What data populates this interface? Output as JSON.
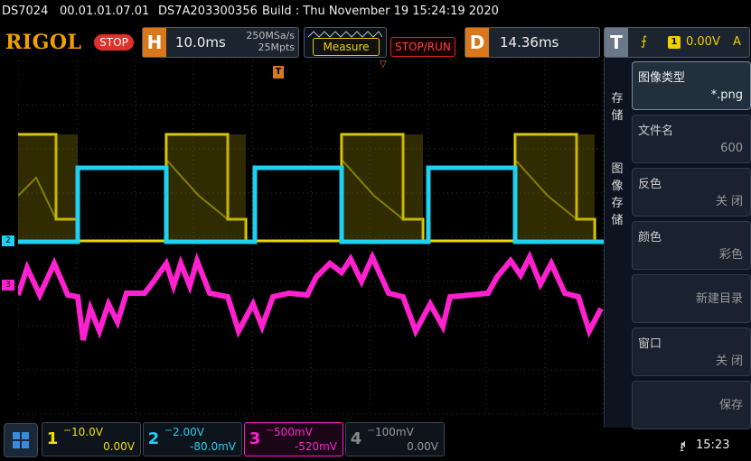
{
  "info": {
    "model": "DS7024",
    "version": "00.01.01.07.01",
    "serial": "DS7A203300356",
    "build": "Build : Thu November 19 15:24:19 2020"
  },
  "toolbar": {
    "logo": "RIGOL",
    "run_state": "STOP",
    "horizontal_letter": "H",
    "timebase": "10.0ms",
    "sample_rate": "250MSa/s",
    "memory_depth": "25Mpts",
    "measure_label": "Measure",
    "stop_run_label": "STOP/RUN",
    "delay_letter": "D",
    "delay_value": "14.36ms",
    "trigger_letter": "T",
    "trigger_source": "1",
    "trigger_level": "0.00V",
    "trigger_mode": "A"
  },
  "markers": {
    "ch2": "2",
    "ch3": "3",
    "trigger": "T"
  },
  "panel": {
    "tab_save": "存\n储",
    "tab_image_save": "图\n像\n存\n储",
    "items": [
      {
        "label": "图像类型",
        "value": "*.png"
      },
      {
        "label": "文件名",
        "value": "600"
      },
      {
        "label": "反色",
        "value": "关 闭"
      },
      {
        "label": "颜色",
        "value": "彩色"
      },
      {
        "label": "",
        "value": "新建目录"
      },
      {
        "label": "窗口",
        "value": "关 闭"
      },
      {
        "label": "",
        "value": "保存"
      }
    ]
  },
  "channels": [
    {
      "num": "1",
      "scale": "10.0V",
      "offset": "0.00V",
      "color": "#f0e000"
    },
    {
      "num": "2",
      "scale": "2.00V",
      "offset": "-80.0mV",
      "color": "#20d0f0"
    },
    {
      "num": "3",
      "scale": "500mV",
      "offset": "-520mV",
      "color": "#ff20d0"
    },
    {
      "num": "4",
      "scale": "100mV",
      "offset": "0.00V",
      "color": "#888888"
    }
  ],
  "status": {
    "time": "15:23"
  },
  "colors": {
    "ch1": "#f0e000",
    "ch2": "#20d0f0",
    "ch3": "#ff20d0",
    "accent": "#d9781a"
  }
}
